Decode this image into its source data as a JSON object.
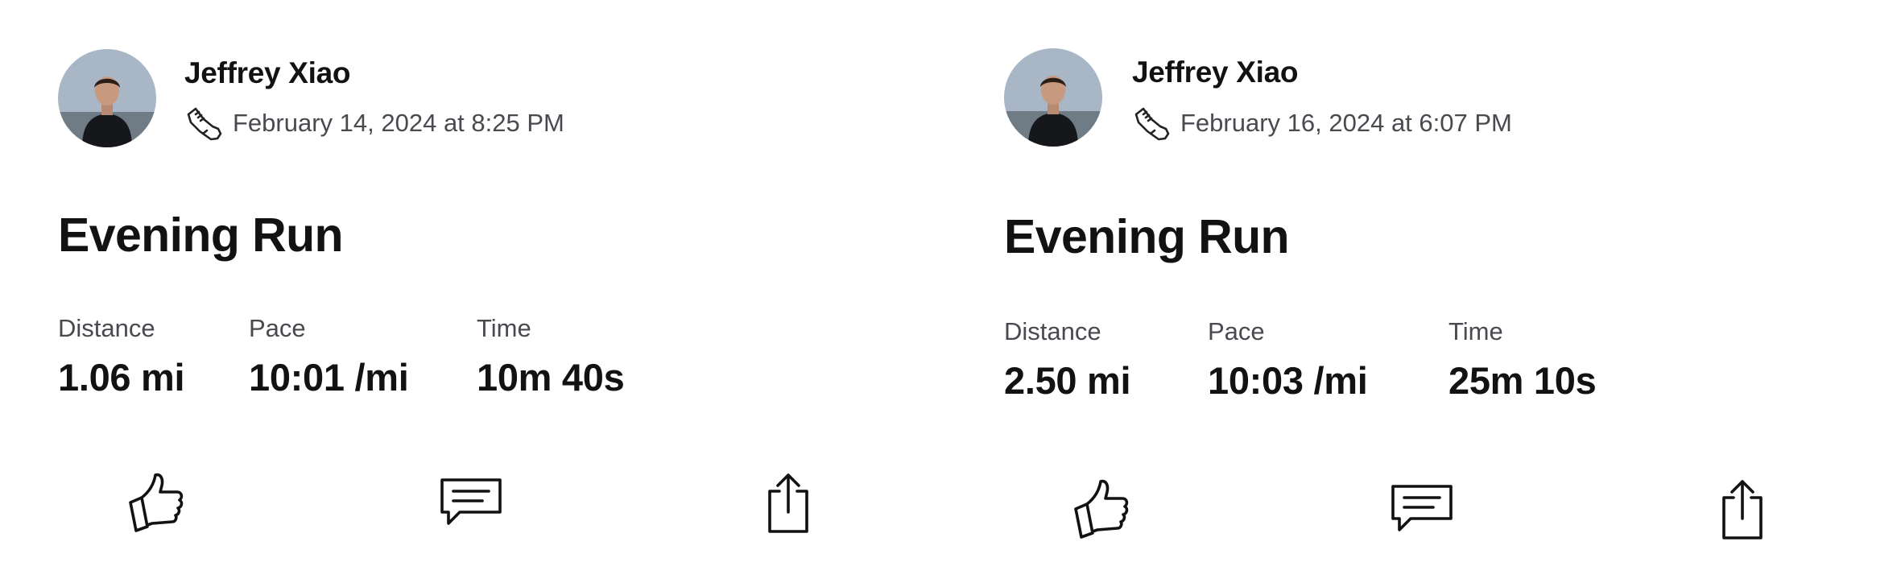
{
  "feed": {
    "activities": [
      {
        "athlete": {
          "name": "Jeffrey Xiao"
        },
        "sport_icon": "running-shoe-icon",
        "date": "February 14, 2024 at 8:25 PM",
        "title": "Evening Run",
        "stats": [
          {
            "label": "Distance",
            "value": "1.06 mi"
          },
          {
            "label": "Pace",
            "value": "10:01 /mi"
          },
          {
            "label": "Time",
            "value": "10m 40s"
          }
        ],
        "actions": [
          "thumbs-up-icon",
          "comment-icon",
          "share-icon"
        ]
      },
      {
        "athlete": {
          "name": "Jeffrey Xiao"
        },
        "sport_icon": "running-shoe-icon",
        "date": "February 16, 2024 at 6:07 PM",
        "title": "Evening Run",
        "stats": [
          {
            "label": "Distance",
            "value": "2.50 mi"
          },
          {
            "label": "Pace",
            "value": "10:03 /mi"
          },
          {
            "label": "Time",
            "value": "25m 10s"
          }
        ],
        "actions": [
          "thumbs-up-icon",
          "comment-icon",
          "share-icon"
        ]
      }
    ]
  },
  "colors": {
    "text_primary": "#121212",
    "text_secondary": "#494950",
    "background": "#ffffff"
  }
}
